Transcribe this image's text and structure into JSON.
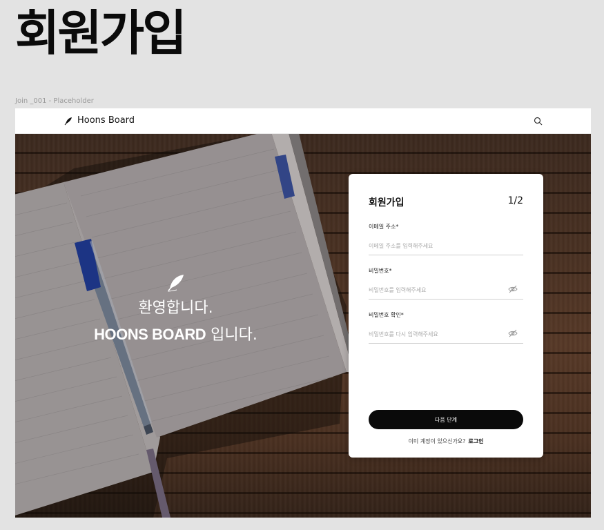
{
  "page_title": "회원가입",
  "frame_label": "Join _001 - Placeholder",
  "navbar": {
    "brand_name": "Hoons Board",
    "brand_icon": "feather-icon",
    "search_icon": "search-icon"
  },
  "hero": {
    "welcome_line1": "환영합니다.",
    "welcome_brand": "HOONS BOARD",
    "welcome_suffix": " 입니다.",
    "icon": "feather-icon"
  },
  "signup_card": {
    "title": "회원가입",
    "step": "1/2",
    "fields": [
      {
        "label": "이메일 주소*",
        "placeholder": "이메일 주소를 입력해주세요",
        "value": ""
      },
      {
        "label": "비밀번호*",
        "placeholder": "비밀번호를 입력해주세요",
        "value": ""
      },
      {
        "label": "비밀번호 확인*",
        "placeholder": "비밀번호를 다시 입력해주세요",
        "value": ""
      }
    ],
    "next_button": "다음 단계",
    "login_prompt": "이미 계정이 있으신가요?",
    "login_link": "로그인"
  },
  "colors": {
    "primary_button": "#0a0a0a",
    "background": "#e3e3e3",
    "card": "#ffffff"
  }
}
